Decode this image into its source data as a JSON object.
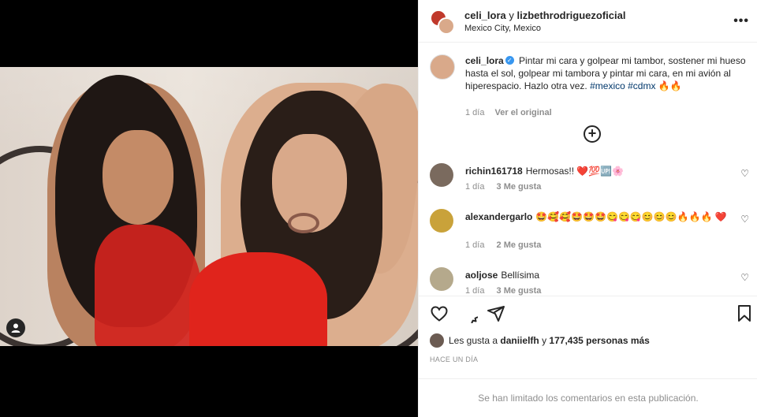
{
  "header": {
    "user1": "celi_lora",
    "connector": "y",
    "user2": "lizbethrodriguezoficial",
    "location": "Mexico City, Mexico",
    "more": "•••"
  },
  "caption": {
    "username": "celi_lora",
    "text": "Pintar mi cara y golpear mi tambor, sostener mi hueso hasta el sol, golpear mi tambora y pintar mi cara, en mi avión al hiperespacio. Hazlo otra vez.",
    "tags": "#mexico #cdmx",
    "emoji": "🔥🔥",
    "time": "1 día",
    "see_original": "Ver el original"
  },
  "comments": [
    {
      "username": "richin161718",
      "text": "Hermosas!! ❤️💯🆙🌸",
      "time": "1 día",
      "likes": "3 Me gusta"
    },
    {
      "username": "alexandergarlo",
      "text": "🤩🥰🥰🤩🤩🤩😋😋😋😊😊😊🔥🔥🔥 ❤️",
      "time": "1 día",
      "likes": "2 Me gusta"
    },
    {
      "username": "aoljose",
      "text": "Bellísima",
      "time": "1 día",
      "likes": "3 Me gusta"
    }
  ],
  "likes_line": {
    "prefix": "Les gusta a",
    "user": "daniielfh",
    "middle": "y",
    "count": "177,435 personas más"
  },
  "time_ago": "HACE UN DÍA",
  "limited_notice": "Se han limitado los comentarios en esta publicación.",
  "icons": {
    "more": "more-horizontal-icon",
    "add": "add-circle-icon",
    "like": "heart-icon",
    "comment": "comment-icon",
    "share": "send-icon",
    "save": "bookmark-icon",
    "user_badge": "user-icon"
  }
}
